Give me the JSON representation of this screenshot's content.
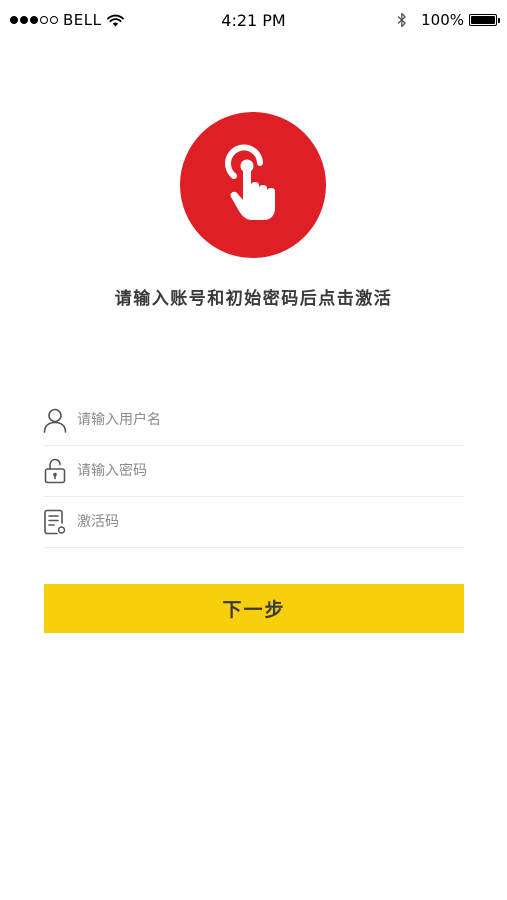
{
  "status_bar": {
    "carrier": "BELL",
    "time": "4:21 PM",
    "battery": "100%",
    "signal_filled": 3,
    "signal_total": 5
  },
  "hero": {
    "icon": "tap-hand-icon",
    "color": "#de1f26",
    "instruction": "请输入账号和初始密码后点击激活"
  },
  "form": {
    "username": {
      "value": "",
      "placeholder": "请输入用户名",
      "icon": "user-icon"
    },
    "password": {
      "value": "",
      "placeholder": "请输入密码",
      "icon": "lock-icon"
    },
    "activation_code": {
      "value": "",
      "placeholder": "激活码",
      "icon": "document-icon"
    }
  },
  "next_button": {
    "label": "下一步",
    "color": "#f8cf0c"
  }
}
